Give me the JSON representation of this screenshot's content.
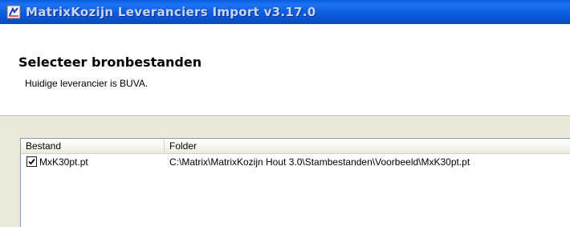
{
  "window": {
    "title": "MatrixKozijn Leveranciers Import v3.17.0",
    "icon": "app-icon"
  },
  "header": {
    "title": "Selecteer bronbestanden",
    "subtitle": "Huidige leverancier is BUVA."
  },
  "file_list": {
    "columns": [
      "Bestand",
      "Folder"
    ],
    "rows": [
      {
        "checked": true,
        "file": "MxK30pt.pt",
        "folder": "C:\\Matrix\\MatrixKozijn Hout 3.0\\Stambestanden\\Voorbeeld\\MxK30pt.pt"
      }
    ]
  },
  "colors": {
    "titlebar": "#0a5ce0",
    "window_bg": "#ece9d8",
    "list_border": "#7f9db9"
  }
}
